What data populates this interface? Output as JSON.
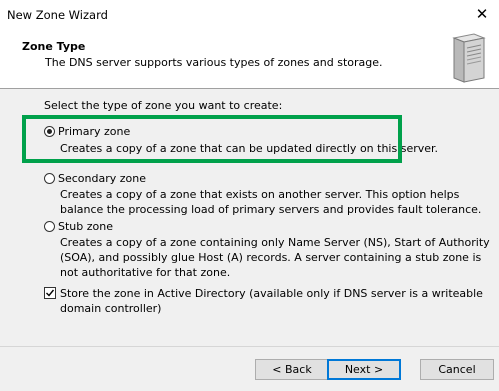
{
  "window": {
    "title": "New Zone Wizard",
    "close_glyph": "✕"
  },
  "header": {
    "title": "Zone Type",
    "subtitle": "The DNS server supports various types of zones and storage.",
    "icon": "server-icon"
  },
  "body": {
    "prompt": "Select the type of zone you want to create:",
    "options": [
      {
        "label": "Primary zone",
        "checked": true,
        "description": "Creates a copy of a zone that can be updated directly on this server."
      },
      {
        "label": "Secondary zone",
        "checked": false,
        "description": "Creates a copy of a zone that exists on another server. This option helps balance the processing load of primary servers and provides fault tolerance."
      },
      {
        "label": "Stub zone",
        "checked": false,
        "description": "Creates a copy of a zone containing only Name Server (NS), Start of Authority (SOA), and possibly glue Host (A) records. A server containing a stub zone is not authoritative for that zone."
      }
    ],
    "store_ad": {
      "checked": true,
      "label": "Store the zone in Active Directory (available only if DNS server is a writeable domain controller)"
    },
    "highlight_color": "#00a14b"
  },
  "footer": {
    "back": "< Back",
    "next": "Next >",
    "cancel": "Cancel"
  }
}
